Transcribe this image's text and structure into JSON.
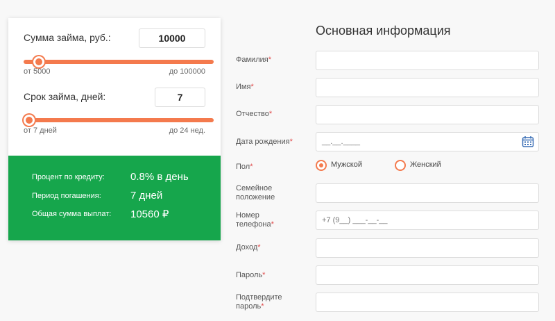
{
  "calculator": {
    "amount": {
      "label": "Сумма займа, руб.:",
      "value": "10000",
      "min_label": "от 5000",
      "max_label": "до 100000",
      "slider_fraction": 0.08
    },
    "term": {
      "label": "Срок займа, дней:",
      "value": "7",
      "min_label": "от 7 дней",
      "max_label": "до 24 нед.",
      "slider_fraction": 0.0
    },
    "summary": {
      "rate_label": "Процент по кредиту:",
      "rate_value": "0.8% в день",
      "period_label": "Период погашения:",
      "period_value": "7 дней",
      "total_label": "Общая сумма выплат:",
      "total_value": "10560 ₽"
    }
  },
  "form": {
    "title": "Основная информация",
    "fields": {
      "last_name": "Фамилия",
      "first_name": "Имя",
      "patronymic": "Отчество",
      "birth_date": "Дата рождения",
      "birth_date_placeholder": "__.__.____",
      "gender": "Пол",
      "marital_1": "Семейное",
      "marital_2": "положение",
      "phone_1": "Номер",
      "phone_2": "телефона",
      "phone_placeholder": "+7 (9__) ___-__-__",
      "income": "Доход",
      "password": "Пароль",
      "confirm_1": "Подтвердите",
      "confirm_2": "пароль"
    },
    "required_mark": "*",
    "gender_options": {
      "male": "Мужской",
      "female": "Женский",
      "selected": "male"
    }
  },
  "colors": {
    "accent": "#f47a4d",
    "summary_bg": "#16a64c",
    "required": "#e04848"
  }
}
